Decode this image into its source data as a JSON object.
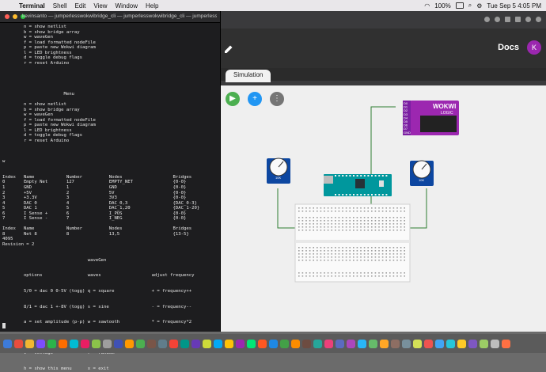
{
  "menubar": {
    "app": "Terminal",
    "items": [
      "Shell",
      "Edit",
      "View",
      "Window",
      "Help"
    ],
    "battery": "100%",
    "datetime": "Tue Sep 5  4:05 PM"
  },
  "terminal": {
    "title": "kevinsanto — jumperlesswokwibridge_cli — jumperlesswokwibridge_cli — jumperlesswokwi...",
    "lines": [
      "        n = show netlist",
      "        b = show bridge array",
      "        w = waveGen",
      "        f = load formatted nodeFile",
      "        p = paste new Wokwi diagram",
      "        l = LED brightness",
      "        d = toggle debug flags",
      "        r = reset Arduino",
      "",
      "",
      "",
      "",
      "",
      "                       Menu",
      "",
      "        n = show netlist",
      "        b = show bridge array",
      "        w = waveGen",
      "        f = load formatted nodeFile",
      "        p = paste new Wokwi diagram",
      "        l = LED brightness",
      "        d = toggle debug flags",
      "        r = reset Arduino",
      "",
      "",
      "",
      "w",
      "",
      "",
      "Index   Name            Number          Nodes                   Bridges",
      "0       Empty Net       127             EMPTY_NET               {0-0}",
      "1       GND             1               GND                     {0-0}",
      "2       +5V             2               5V                      {0-0}",
      "3       +3.3V           3               3V3                     {0-0}",
      "4       DAC 0           4               DAC_0,3                 {DAC_0-3}",
      "5       DAC 1           5               DAC_1,20                {DAC_1-20}",
      "6       I Sense +       6               I_POS                   {0-0}",
      "7       I Sense -       7               I_NEG                   {0-0}",
      "",
      "Index   Name            Number          Nodes                   Bridges",
      "8       Net 8           8               13,5                    {13-5}",
      "4095",
      "Revision = 2",
      "",
      "",
      "                                waveGen",
      "",
      "",
      "        options                 waves                   adjust frequency",
      "",
      "",
      "        5/0 = dac 0 0-5V (togg) q = square              + = frequency++",
      "",
      "",
      "        8/1 = dac 1 +-8V (togg) s = sine                - = frequency--",
      "",
      "",
      "        a = set amplitude (p-p) w = sawtooth            * = frequency*2",
      "",
      "",
      "        o = set offset          t = triangle            / = frequency/2",
      "",
      "",
      "        v = voltage             r = random",
      "",
      "",
      "        h = show this menu      x = exit"
    ]
  },
  "app": {
    "docs_label": "Docs",
    "avatar_initial": "K",
    "tab_label": "Simulation",
    "play_icon": "▶",
    "add_icon": "+",
    "more_icon": "⋮",
    "logic_title": "WOKWI",
    "logic_subtitle": "LOGIC",
    "logic_pins": [
      "D0",
      "D1",
      "D2",
      "D3",
      "D4",
      "D5",
      "D6",
      "D7",
      "GND"
    ],
    "pot_label": "10K"
  },
  "colors": {
    "play": "#4caf50",
    "add": "#2196f3",
    "more": "#757575",
    "arduino": "#00979d",
    "logic": "#9c27b0",
    "avatar": "#9b27af",
    "wire": "#2e7d32"
  },
  "dock_colors": [
    "#3d7bd9",
    "#e84d3d",
    "#f2b632",
    "#7c4dff",
    "#2db34a",
    "#ff6d00",
    "#00bcd4",
    "#e91e63",
    "#8bc34a",
    "#9e9e9e",
    "#3f51b5",
    "#ff9800",
    "#4caf50",
    "#795548",
    "#607d8b",
    "#f44336",
    "#009688",
    "#673ab7",
    "#cddc39",
    "#03a9f4",
    "#ffc107",
    "#9c27b0",
    "#00e676",
    "#ff5722",
    "#1e88e5",
    "#43a047",
    "#fb8c00",
    "#6d4c41",
    "#26a69a",
    "#ec407a",
    "#5c6bc0",
    "#ab47bc",
    "#29b6f6",
    "#66bb6a",
    "#ffa726",
    "#8d6e63",
    "#78909c",
    "#d4e157",
    "#ef5350",
    "#42a5f5",
    "#26c6da",
    "#ffca28",
    "#7e57c2",
    "#9ccc65",
    "#bdbdbd",
    "#ff7043"
  ]
}
